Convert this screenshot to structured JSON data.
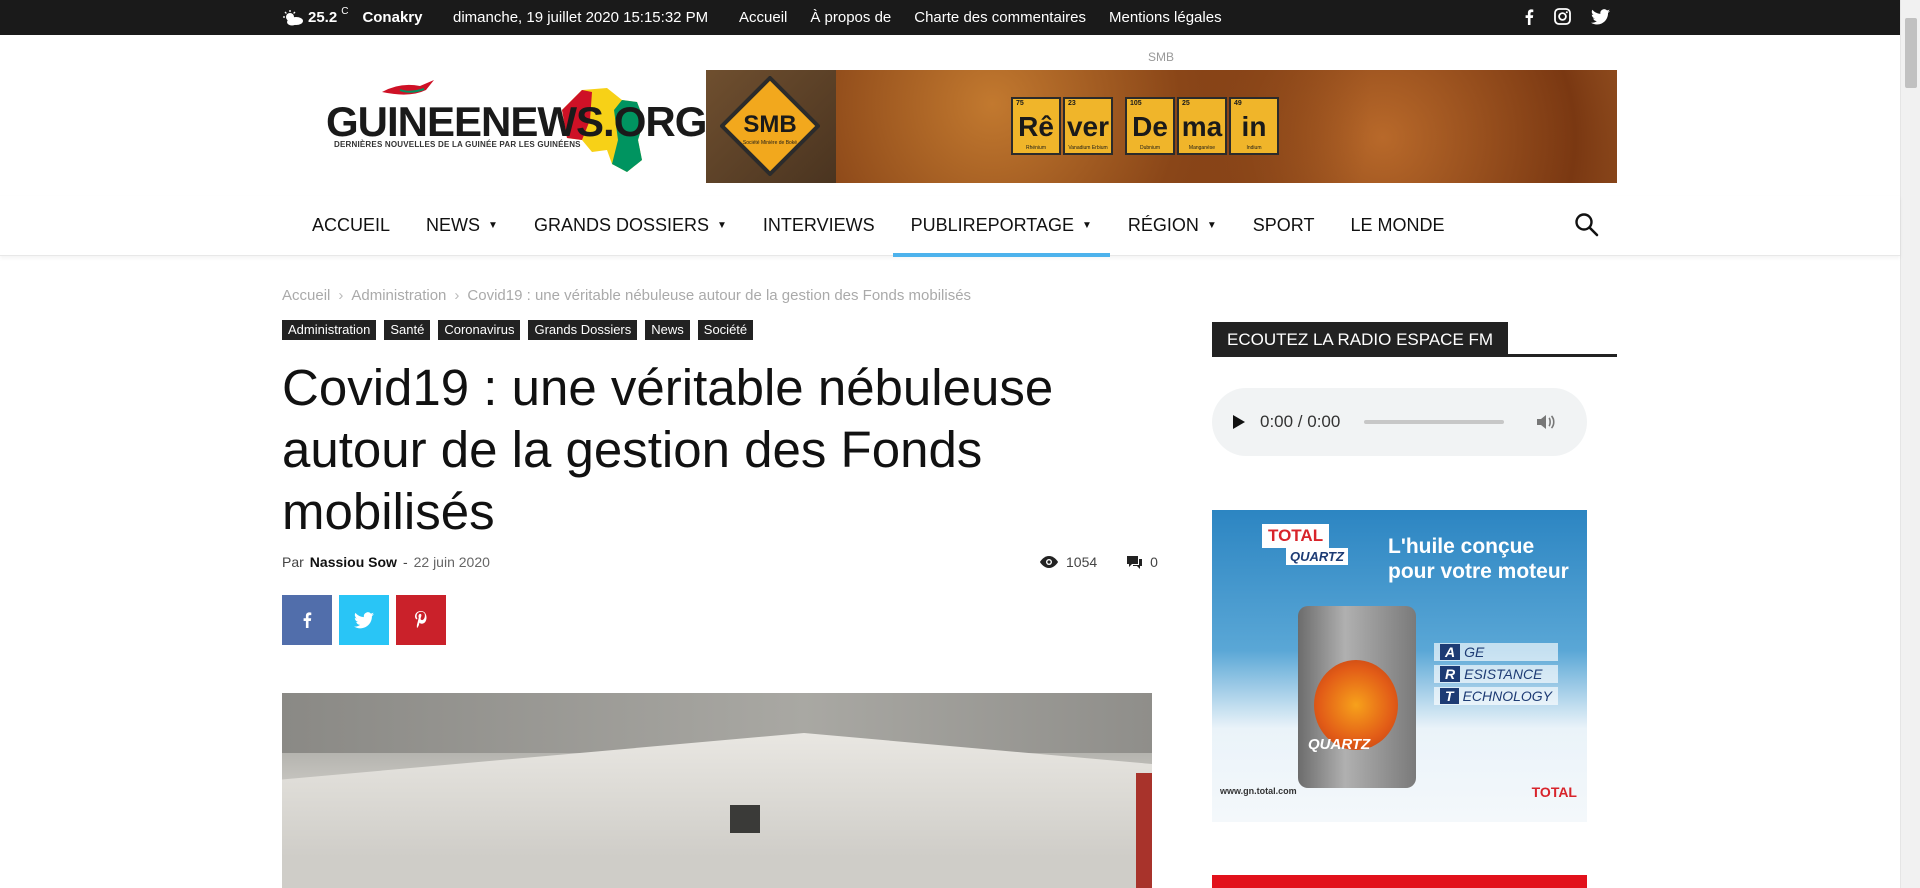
{
  "topbar": {
    "temperature": "25.2",
    "unit": "C",
    "city": "Conakry",
    "datetime": "dimanche, 19 juillet 2020 15:15:32 PM",
    "links": [
      "Accueil",
      "À propos de",
      "Charte des commentaires",
      "Mentions légales"
    ]
  },
  "header": {
    "logo_main": "GUINEENEWS",
    "logo_suffix": ".ORG",
    "logo_tagline": "DERNIÈRES NOUVELLES DE LA GUINÉE PAR LES GUINÉENS",
    "ad_label": "SMB",
    "banner": {
      "smb_text": "SMB",
      "smb_sub": "Société Minière de Boké",
      "elements": [
        {
          "num": "75",
          "sym": "Rê",
          "name": "Rhénium"
        },
        {
          "num": "23",
          "sym": "ver",
          "name": "Vanadium Erbium"
        },
        {
          "num": "105",
          "sym": "De",
          "name": "Dubnium"
        },
        {
          "num": "25",
          "sym": "ma",
          "name": "Manganèse"
        },
        {
          "num": "49",
          "sym": "in",
          "name": "Indium"
        }
      ]
    }
  },
  "nav": {
    "items": [
      {
        "label": "ACCUEIL",
        "dropdown": false
      },
      {
        "label": "NEWS",
        "dropdown": true
      },
      {
        "label": "GRANDS DOSSIERS",
        "dropdown": true
      },
      {
        "label": "INTERVIEWS",
        "dropdown": false
      },
      {
        "label": "PUBLIREPORTAGE",
        "dropdown": true
      },
      {
        "label": "RÉGION",
        "dropdown": true
      },
      {
        "label": "SPORT",
        "dropdown": false
      },
      {
        "label": "LE MONDE",
        "dropdown": false
      }
    ],
    "active": "PUBLIREPORTAGE",
    "accent": "#4db2ec"
  },
  "breadcrumb": [
    "Accueil",
    "Administration",
    "Covid19 : une véritable nébuleuse autour de la gestion des Fonds mobilisés"
  ],
  "article": {
    "categories": [
      "Administration",
      "Santé",
      "Coronavirus",
      "Grands Dossiers",
      "News",
      "Société"
    ],
    "title": "Covid19 : une véritable nébuleuse autour de la gestion des Fonds mobilisés",
    "by": "Par",
    "author": "Nassiou Sow",
    "dash": "-",
    "date": "22 juin 2020",
    "views": "1054",
    "comments": "0"
  },
  "share_colors": {
    "facebook": "#516eab",
    "twitter": "#29c5f6",
    "pinterest": "#ca212a"
  },
  "sidebar": {
    "radio_title": "ECOUTEZ LA RADIO ESPACE FM",
    "player_time": "0:00 / 0:00",
    "ad": {
      "brand": "TOTAL",
      "sub": "QUARTZ",
      "headline_1": "L'huile conçue",
      "headline_2": "pour votre moteur",
      "art": [
        {
          "letter": "A",
          "rest": "GE"
        },
        {
          "letter": "R",
          "rest": "ESISTANCE"
        },
        {
          "letter": "T",
          "rest": "ECHNOLOGY"
        }
      ],
      "can_label": "QUARTZ",
      "url": "www.gn.total.com",
      "footer_brand": "TOTAL"
    }
  }
}
